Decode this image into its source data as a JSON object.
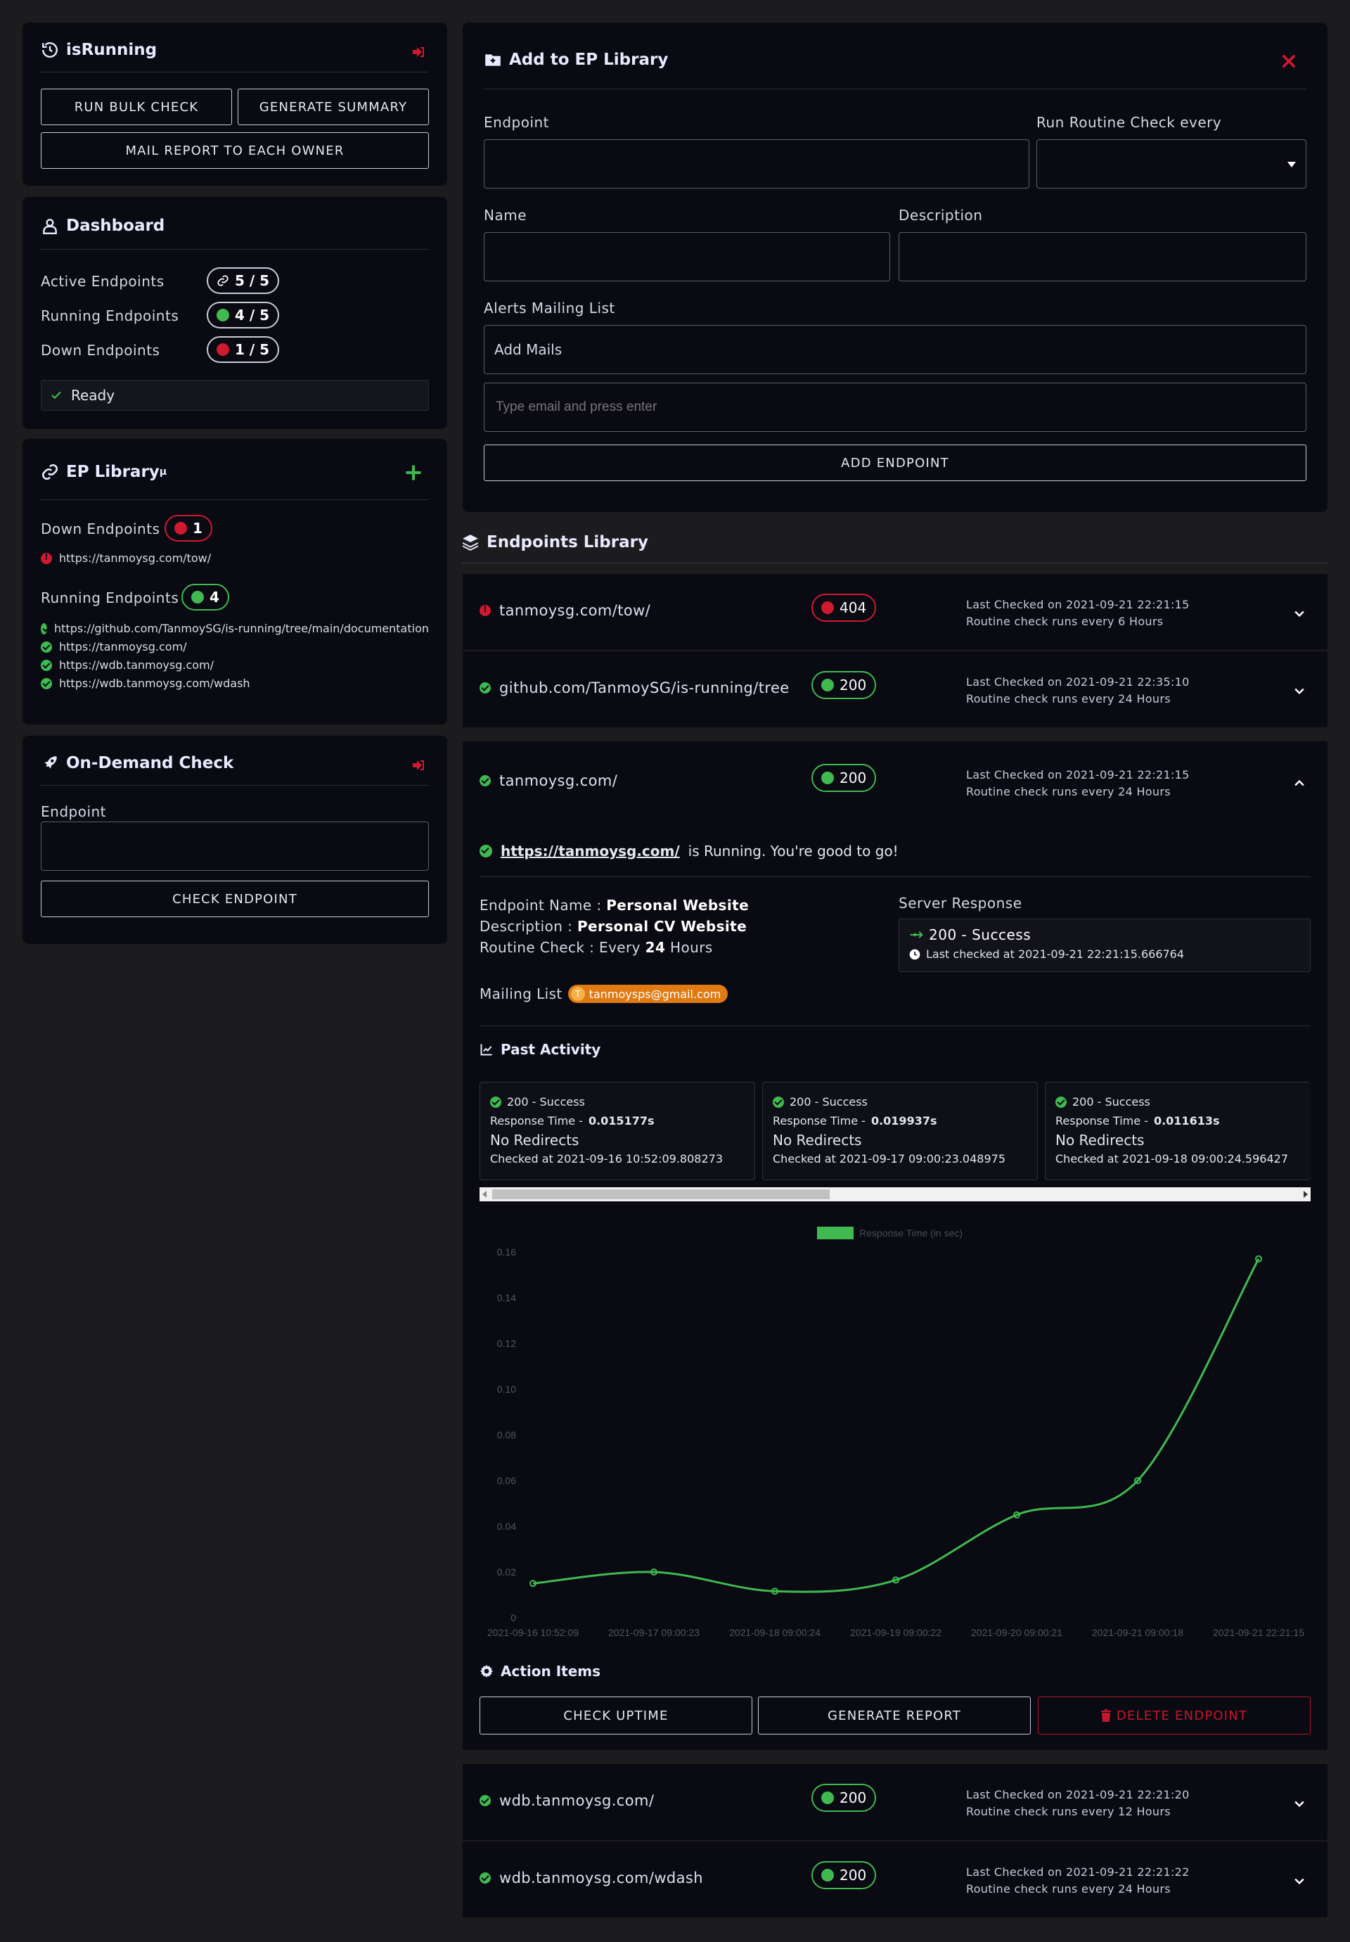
{
  "app": {
    "title": "isRunning",
    "buttons": {
      "bulk": "RUN BULK CHECK",
      "summary": "GENERATE SUMMARY",
      "mail": "MAIL REPORT TO EACH OWNER"
    }
  },
  "dashboard": {
    "title": "Dashboard",
    "rows": [
      {
        "label": "Active Endpoints",
        "value": "5 / 5"
      },
      {
        "label": "Running Endpoints",
        "value": "4 / 5"
      },
      {
        "label": "Down Endpoints",
        "value": "1 / 5"
      }
    ],
    "status": "Ready"
  },
  "library_side": {
    "title": "EP Library",
    "title_sup": "µ",
    "down_label": "Down Endpoints",
    "down_count": "1",
    "down_urls": [
      "https://tanmoysg.com/tow/"
    ],
    "running_label": "Running Endpoints",
    "running_count": "4",
    "running_urls": [
      "https://github.com/TanmoySG/is-running/tree/main/documentation",
      "https://tanmoysg.com/",
      "https://wdb.tanmoysg.com/",
      "https://wdb.tanmoysg.com/wdash"
    ]
  },
  "ondemand": {
    "title": "On-Demand Check",
    "endpoint_label": "Endpoint",
    "button": "CHECK ENDPOINT"
  },
  "add_form": {
    "title": "Add to EP Library",
    "endpoint_label": "Endpoint",
    "routine_label": "Run Routine Check every",
    "name_label": "Name",
    "desc_label": "Description",
    "alerts_label": "Alerts Mailing List",
    "add_mails": "Add Mails",
    "email_placeholder": "Type email and press enter",
    "button": "ADD ENDPOINT"
  },
  "library": {
    "title": "Endpoints Library",
    "last_prefix": "Last Checked on",
    "items": [
      {
        "name": "tanmoysg.com/tow/",
        "code": "404",
        "status": "down",
        "last": "2021-09-21 22:21:15",
        "routine": "Routine check runs every 6 Hours"
      },
      {
        "name": "github.com/TanmoySG/is-running/tree",
        "code": "200",
        "status": "up",
        "last": "2021-09-21 22:35:10",
        "routine": "Routine check runs every 24 Hours"
      },
      {
        "name": "tanmoysg.com/",
        "code": "200",
        "status": "up",
        "last": "2021-09-21 22:21:15",
        "routine": "Routine check runs every 24 Hours"
      },
      {
        "name": "wdb.tanmoysg.com/",
        "code": "200",
        "status": "up",
        "last": "2021-09-21 22:21:20",
        "routine": "Routine check runs every 12 Hours"
      },
      {
        "name": "wdb.tanmoysg.com/wdash",
        "code": "200",
        "status": "up",
        "last": "2021-09-21 22:21:22",
        "routine": "Routine check runs every 24 Hours"
      }
    ]
  },
  "detail": {
    "link": "https://tanmoysg.com/",
    "running_text": "is Running. You're good to go!",
    "ep_name_label": "Endpoint Name :",
    "ep_name": "Personal Website",
    "desc_label": "Description :",
    "desc": "Personal CV Website",
    "routine_label": "Routine Check :",
    "routine_pre": "Every",
    "routine_val": "24",
    "routine_post": "Hours",
    "server_label": "Server Response",
    "server_status": "200 - Success",
    "server_checked": "Last checked at 2021-09-21 22:21:15.666764",
    "mailing_label": "Mailing List",
    "mailing_initial": "T",
    "mailing_email": "tanmoysps@gmail.com",
    "past_title": "Past Activity",
    "activity": [
      {
        "status": "200 - Success",
        "rt_label": "Response Time -",
        "rt": "0.015177s",
        "redirects": "No Redirects",
        "checked": "Checked at 2021-09-16 10:52:09.808273"
      },
      {
        "status": "200 - Success",
        "rt_label": "Response Time -",
        "rt": "0.019937s",
        "redirects": "No Redirects",
        "checked": "Checked at 2021-09-17 09:00:23.048975"
      },
      {
        "status": "200 - Success",
        "rt_label": "Response Time -",
        "rt": "0.011613s",
        "redirects": "No Redirects",
        "checked": "Checked at 2021-09-18 09:00:24.596427"
      }
    ],
    "actions_title": "Action Items",
    "actions": {
      "uptime": "CHECK UPTIME",
      "report": "GENERATE REPORT",
      "delete": "DELETE ENDPOINT"
    }
  },
  "chart_data": {
    "type": "line",
    "x": [
      "2021-09-16 10:52:09",
      "2021-09-17 09:00:23",
      "2021-09-18 09:00:24",
      "2021-09-19 09:00:22",
      "2021-09-20 09:00:21",
      "2021-09-21 09:00:18",
      "2021-09-21 22:21:15"
    ],
    "series": [
      {
        "name": "Response Time (in sec)",
        "values": [
          0.015,
          0.02,
          0.0116,
          0.0165,
          0.045,
          0.06,
          0.157
        ]
      }
    ],
    "yticks": [
      "0",
      "0.02",
      "0.04",
      "0.06",
      "0.08",
      "0.10",
      "0.12",
      "0.14",
      "0.16"
    ],
    "ylim": [
      0,
      0.16
    ],
    "color": "#3fb950",
    "grid": false,
    "legend": "top"
  },
  "colors": {
    "accent_green": "#3fb950",
    "danger": "#d0192f",
    "mail_pill": "#e07a12"
  }
}
